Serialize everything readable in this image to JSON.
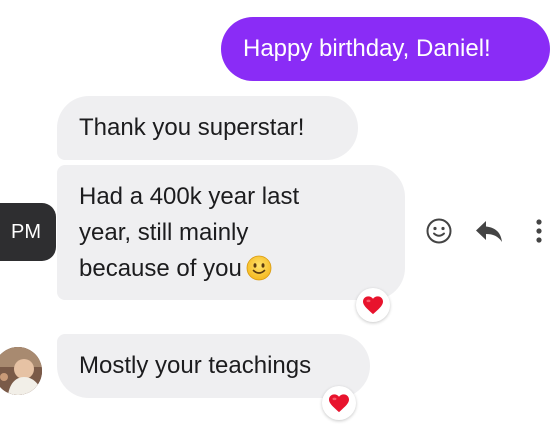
{
  "messages": [
    {
      "text": "Happy birthday, Daniel!",
      "direction": "outgoing"
    },
    {
      "text": "Thank you superstar!",
      "direction": "incoming"
    },
    {
      "lines": [
        "Had a 400k year last",
        "year, still mainly",
        "because of you"
      ],
      "trailing_emoji": "slightly-smiling-face",
      "direction": "incoming",
      "reaction": "heart"
    },
    {
      "text": "Mostly your teachings",
      "direction": "incoming",
      "reaction": "heart"
    }
  ],
  "timestamp": "PM",
  "actions": [
    {
      "icon": "react-smiley-icon"
    },
    {
      "icon": "reply-icon"
    },
    {
      "icon": "more-options-icon"
    }
  ],
  "colors": {
    "outgoing_bubble": "#8a2cf6",
    "incoming_bubble": "#efeff1",
    "timestamp_pill": "#2e2e30",
    "reaction_heart": "#e8132d",
    "action_icon": "#444444"
  }
}
